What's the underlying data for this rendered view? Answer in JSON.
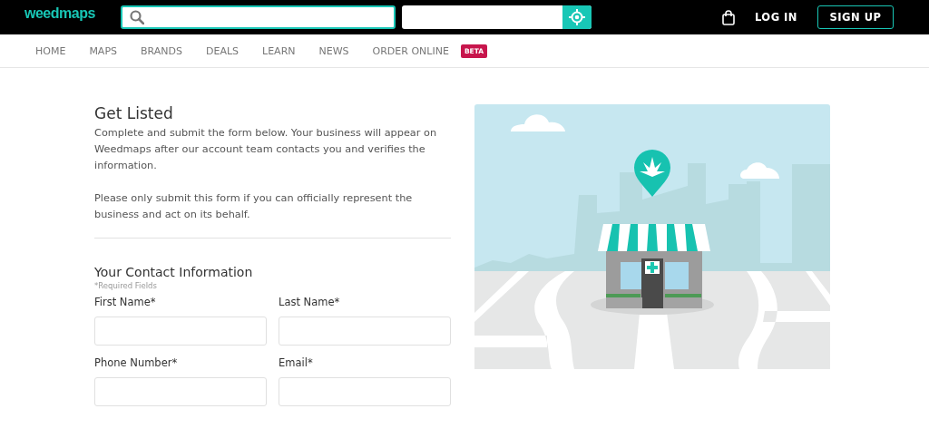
{
  "header": {
    "logo": "weedmaps",
    "login": "LOG IN",
    "signup": "SIGN UP"
  },
  "nav": [
    {
      "label": "HOME"
    },
    {
      "label": "MAPS"
    },
    {
      "label": "BRANDS"
    },
    {
      "label": "DEALS"
    },
    {
      "label": "LEARN"
    },
    {
      "label": "NEWS"
    },
    {
      "label": "ORDER ONLINE",
      "badge": "BETA"
    }
  ],
  "form": {
    "title": "Get Listed",
    "paragraphs": [
      "Complete and submit the form below. Your business will appear on Weedmaps after our account team contacts you and verifies the information.",
      "Please only submit this form if you can officially represent the business and act on its behalf."
    ],
    "section": "Your Contact Information",
    "note": "*Required Fields",
    "fields": [
      {
        "label": "First Name*"
      },
      {
        "label": "Last Name*"
      },
      {
        "label": "Phone Number*"
      },
      {
        "label": "Email*"
      }
    ]
  }
}
